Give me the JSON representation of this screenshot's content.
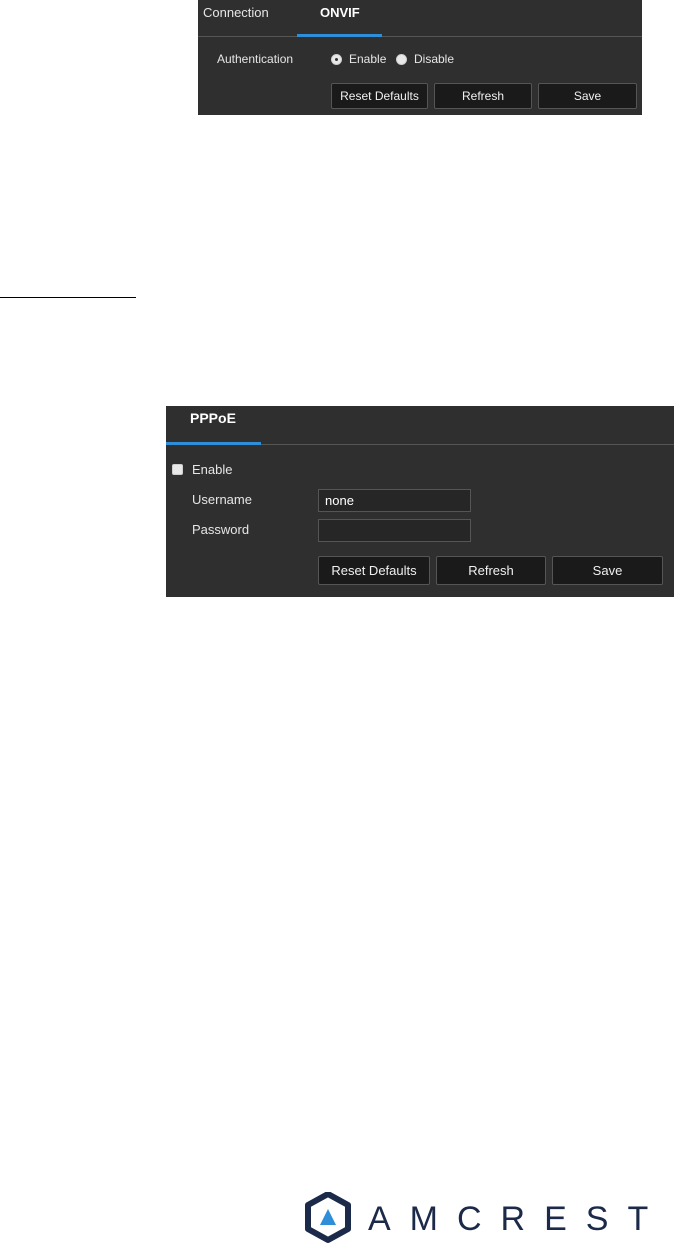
{
  "onvif": {
    "tabs": [
      {
        "label": "Connection",
        "active": false
      },
      {
        "label": "ONVIF",
        "active": true
      }
    ],
    "authentication_label": "Authentication",
    "options": [
      {
        "label": "Enable",
        "selected": true
      },
      {
        "label": "Disable",
        "selected": false
      }
    ],
    "buttons": {
      "reset": "Reset Defaults",
      "refresh": "Refresh",
      "save": "Save"
    }
  },
  "pppoe": {
    "tab": "PPPoE",
    "enable_label": "Enable",
    "enable_checked": false,
    "username_label": "Username",
    "username_value": "none",
    "password_label": "Password",
    "password_value": "",
    "buttons": {
      "reset": "Reset Defaults",
      "refresh": "Refresh",
      "save": "Save"
    }
  },
  "logo": {
    "text": "AMCREST"
  },
  "colors": {
    "panel_bg": "#2f2f2f",
    "accent": "#2f8ed8",
    "logo": "#1c2a4a"
  }
}
